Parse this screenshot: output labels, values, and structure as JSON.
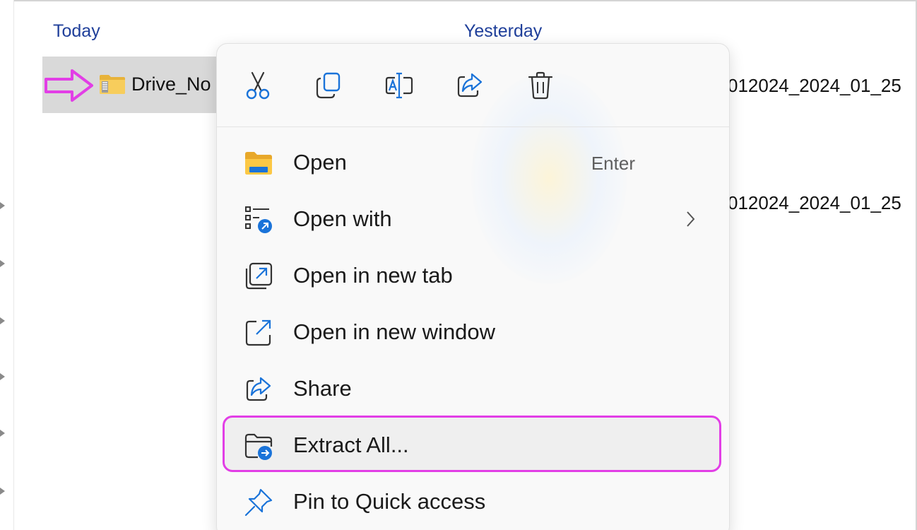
{
  "groups": {
    "today": "Today",
    "yesterday": "Yesterday"
  },
  "file": {
    "name": "Drive_No",
    "icon": "zip-folder-icon"
  },
  "right_column": {
    "row1": "012024_2024_01_25",
    "row2": "012024_2024_01_25"
  },
  "annotation": {
    "color": "#e23ee6",
    "arrow": "pointer-arrow-icon"
  },
  "context_menu": {
    "toolbar": [
      {
        "icon": "cut-icon",
        "label": "Cut"
      },
      {
        "icon": "copy-icon",
        "label": "Copy"
      },
      {
        "icon": "rename-icon",
        "label": "Rename"
      },
      {
        "icon": "share-icon",
        "label": "Share"
      },
      {
        "icon": "delete-icon",
        "label": "Delete"
      }
    ],
    "items": [
      {
        "label": "Open",
        "shortcut": "Enter",
        "icon": "folder-icon"
      },
      {
        "label": "Open with",
        "icon": "open-with-icon",
        "has_submenu": true
      },
      {
        "label": "Open in new tab",
        "icon": "new-tab-icon"
      },
      {
        "label": "Open in new window",
        "icon": "new-window-icon"
      },
      {
        "label": "Share",
        "icon": "share-icon"
      },
      {
        "label": "Extract All...",
        "icon": "extract-icon",
        "highlighted": true
      },
      {
        "label": "Pin to Quick access",
        "icon": "pin-icon"
      }
    ]
  },
  "colors": {
    "accent_blue": "#1a73d9",
    "group_header": "#1f3f9a",
    "selection": "#d9d9d9"
  }
}
